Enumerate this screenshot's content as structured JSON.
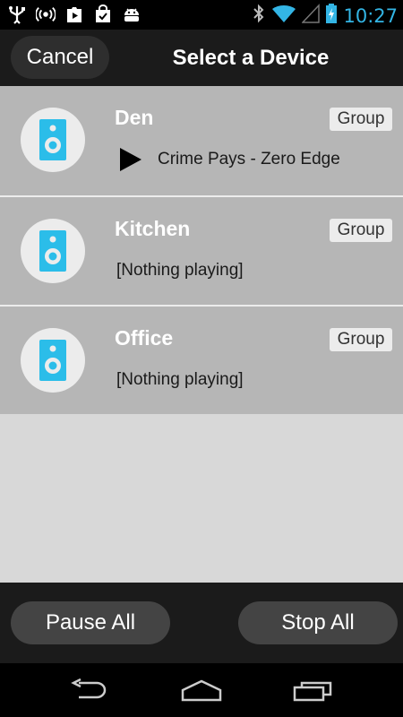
{
  "status_bar": {
    "time": "10:27",
    "left_icons": [
      "usb-icon",
      "broadcast-icon",
      "play-store-icon",
      "shopping-bag-icon",
      "android-icon"
    ],
    "right_icons": [
      "bluetooth-icon",
      "wifi-icon",
      "signal-icon",
      "battery-charging-icon"
    ]
  },
  "header": {
    "cancel_label": "Cancel",
    "title": "Select a Device"
  },
  "devices": [
    {
      "name": "Den",
      "group_label": "Group",
      "status": "Crime Pays - Zero Edge",
      "playing": true
    },
    {
      "name": "Kitchen",
      "group_label": "Group",
      "status": "[Nothing playing]",
      "playing": false
    },
    {
      "name": "Office",
      "group_label": "Group",
      "status": "[Nothing playing]",
      "playing": false
    }
  ],
  "footer": {
    "pause_label": "Pause All",
    "stop_label": "Stop All"
  },
  "nav": {
    "icons": [
      "back-icon",
      "home-icon",
      "recent-apps-icon"
    ]
  },
  "colors": {
    "accent": "#33b5e5",
    "speaker": "#2bbde9",
    "row_bg": "#b6b6b6"
  }
}
